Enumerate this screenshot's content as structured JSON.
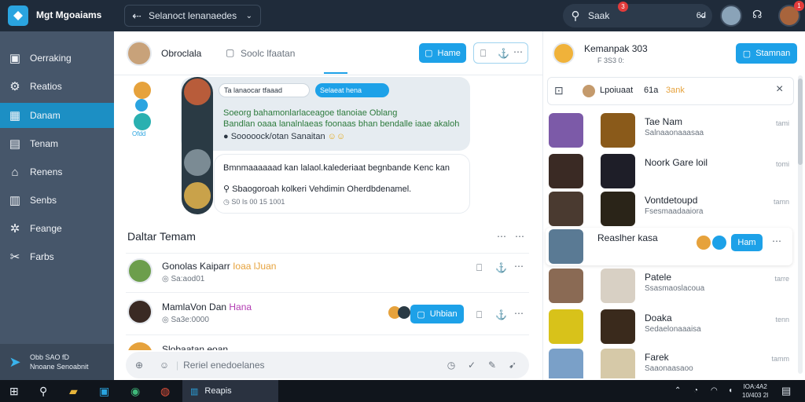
{
  "topbar": {
    "app_name": "Mgt Mgoaiams",
    "nav_label": "Selanoct  lenanaedes",
    "search_text": "Saak",
    "search_suffix": "6d",
    "search_badge": "3",
    "avatar_badge": "1"
  },
  "sidebar": {
    "items": [
      {
        "label": "Oerraking",
        "icon": "image-icon"
      },
      {
        "label": "Reatios",
        "icon": "gear-icon"
      },
      {
        "label": "Danam",
        "icon": "calendar-icon"
      },
      {
        "label": "Tenam",
        "icon": "panel-icon"
      },
      {
        "label": "Renens",
        "icon": "home-icon"
      },
      {
        "label": "Senbs",
        "icon": "grid-icon"
      },
      {
        "label": "Feange",
        "icon": "settings-icon"
      },
      {
        "label": "Farbs",
        "icon": "tools-icon"
      }
    ],
    "active_index": 2,
    "footer_line1": "Obb SAO fD",
    "footer_line2": "Nnoane Senoabnit"
  },
  "chat": {
    "header_name": "Obroclala",
    "header_action": "Soolc lfaatan",
    "header_button": "Hame",
    "side_label": "Ofdd",
    "message1": {
      "chip1": "Ta lanaocar tfaaad",
      "chip2": "Selaeat hena",
      "line1": "Soeorg bahamonlarlaceagoe tlanoiae Oblang",
      "line2": "Bandlan oaaa lanalnlaeas foonaas bhan bendalle iaae akaloh",
      "line3": "Sooooock/otan Sanaitan"
    },
    "message2": {
      "line1": "Bmnmaaaaaad kan lalaol.kalederiaat begnbande Kenc kan",
      "line2": "Sbaogoroah kolkeri Vehdimin Oherdbdenamel.",
      "meta": "S0 Is 00 15 1001"
    },
    "section_title": "Daltar Temam",
    "friends": [
      {
        "name": "Gonolas Kaiparr",
        "tag": "Ioaa lJuan",
        "sub": "Sa:aod01"
      },
      {
        "name": "MamlaVon Dan",
        "tag": "Hana",
        "sub": "Sa3e:0000"
      },
      {
        "name": "Slobaatan eoan",
        "tag": "",
        "sub": ""
      }
    ],
    "friend_button": "Uhbian",
    "composer_placeholder": "Reriel enedoelanes"
  },
  "right_panel": {
    "header_name": "Kemanpak 303",
    "header_sub": "F 3S3 0:",
    "header_button": "Stamnan",
    "filter_label": "Lpoiuaat",
    "filter_tag": "61a",
    "filter_extra": "3ank",
    "rows": [
      {
        "name": "Tae Nam",
        "sub": "Salnaaonaaasaa",
        "time": "tami"
      },
      {
        "name": "Noork Gare loil",
        "sub": "",
        "time": "tomi"
      },
      {
        "name": "Vontdetoupd",
        "sub": "Fsesmaadaaiora",
        "time": "tamn"
      },
      {
        "name": "Reaslher kasa",
        "sub": "",
        "time": ""
      },
      {
        "name": "Patele",
        "sub": "Ssasmaoslacoua",
        "time": "tarre"
      },
      {
        "name": "Doaka",
        "sub": "Sedaelonaaaisa",
        "time": "tenn"
      },
      {
        "name": "Farek",
        "sub": "Saaonaasaoo",
        "time": "tamm"
      }
    ],
    "row_button": "Ham"
  },
  "taskbar": {
    "app_label": "Reapis",
    "clock_time": "IOA:4A2",
    "clock_date": "10/403 2I"
  },
  "colors": {
    "accent": "#1da1e8",
    "sidebar_bg": "#46566a",
    "topbar_bg": "#1f2b3a",
    "active_item": "#1c8fc4"
  }
}
